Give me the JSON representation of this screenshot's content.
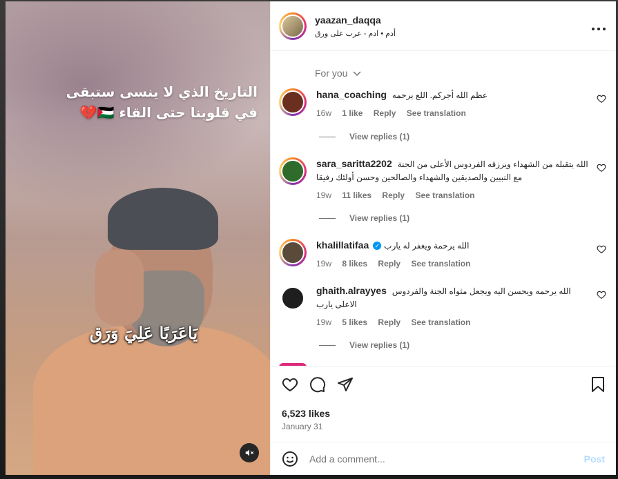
{
  "post": {
    "username": "yaazan_daqqa",
    "subline": "أدم • ادم - عرب على ورق",
    "media_text_line1": "التاريخ الذي لا ينسى ستبقى",
    "media_text_line2": "في قلوبنا حتى القاء 🇵🇸💔",
    "media_calligraphy": "يَاعَرَبًا عَلِيَ وَرَق"
  },
  "comments_section": {
    "filter_label": "For you",
    "comments": [
      {
        "username": "hana_coaching",
        "text": "عظم الله أجركم. اللع يرحمه",
        "time": "16w",
        "likes": "1 like",
        "reply": "Reply",
        "translation": "See translation",
        "view_replies": "View replies (1)",
        "avatar_color": "#6b2f1f"
      },
      {
        "username": "sara_saritta2202",
        "text": "الله يتقبله من الشهداء ويرزقه الفردوس الأعلى من الجنة مع النبيين والصديقين والشهداء والصالحين وحسن أولئك رفيقا",
        "time": "19w",
        "likes": "11 likes",
        "reply": "Reply",
        "translation": "See translation",
        "view_replies": "View replies (1)",
        "avatar_color": "#2f6b2a"
      },
      {
        "username": "khalillatifaa",
        "text": "الله يرحمة ويغفر له يارب",
        "time": "19w",
        "likes": "8 likes",
        "reply": "Reply",
        "translation": "See translation",
        "avatar_color": "#5a4a3a"
      },
      {
        "username": "ghaith.alrayyes",
        "text": "الله يرحمه ويحسن اليه ويجعل مثواه الجنة والفردوس الاعلى يارب",
        "time": "19w",
        "likes": "5 likes",
        "reply": "Reply",
        "translation": "See translation",
        "view_replies": "View replies (1)",
        "avatar_color": "#1e1e1e"
      }
    ]
  },
  "actions": {
    "likes_count": "6,523 likes",
    "date": "January 31"
  },
  "composer": {
    "placeholder": "Add a comment...",
    "post_label": "Post"
  },
  "colors": {
    "accent_blue": "#0095f6",
    "post_disabled": "#b3dbff",
    "muted_text": "#737373"
  },
  "icons": [
    "more-horizontal-icon",
    "chevron-down-icon",
    "heart-icon",
    "comment-icon",
    "share-icon",
    "bookmark-icon",
    "emoji-icon",
    "mute-icon",
    "verified-icon"
  ]
}
